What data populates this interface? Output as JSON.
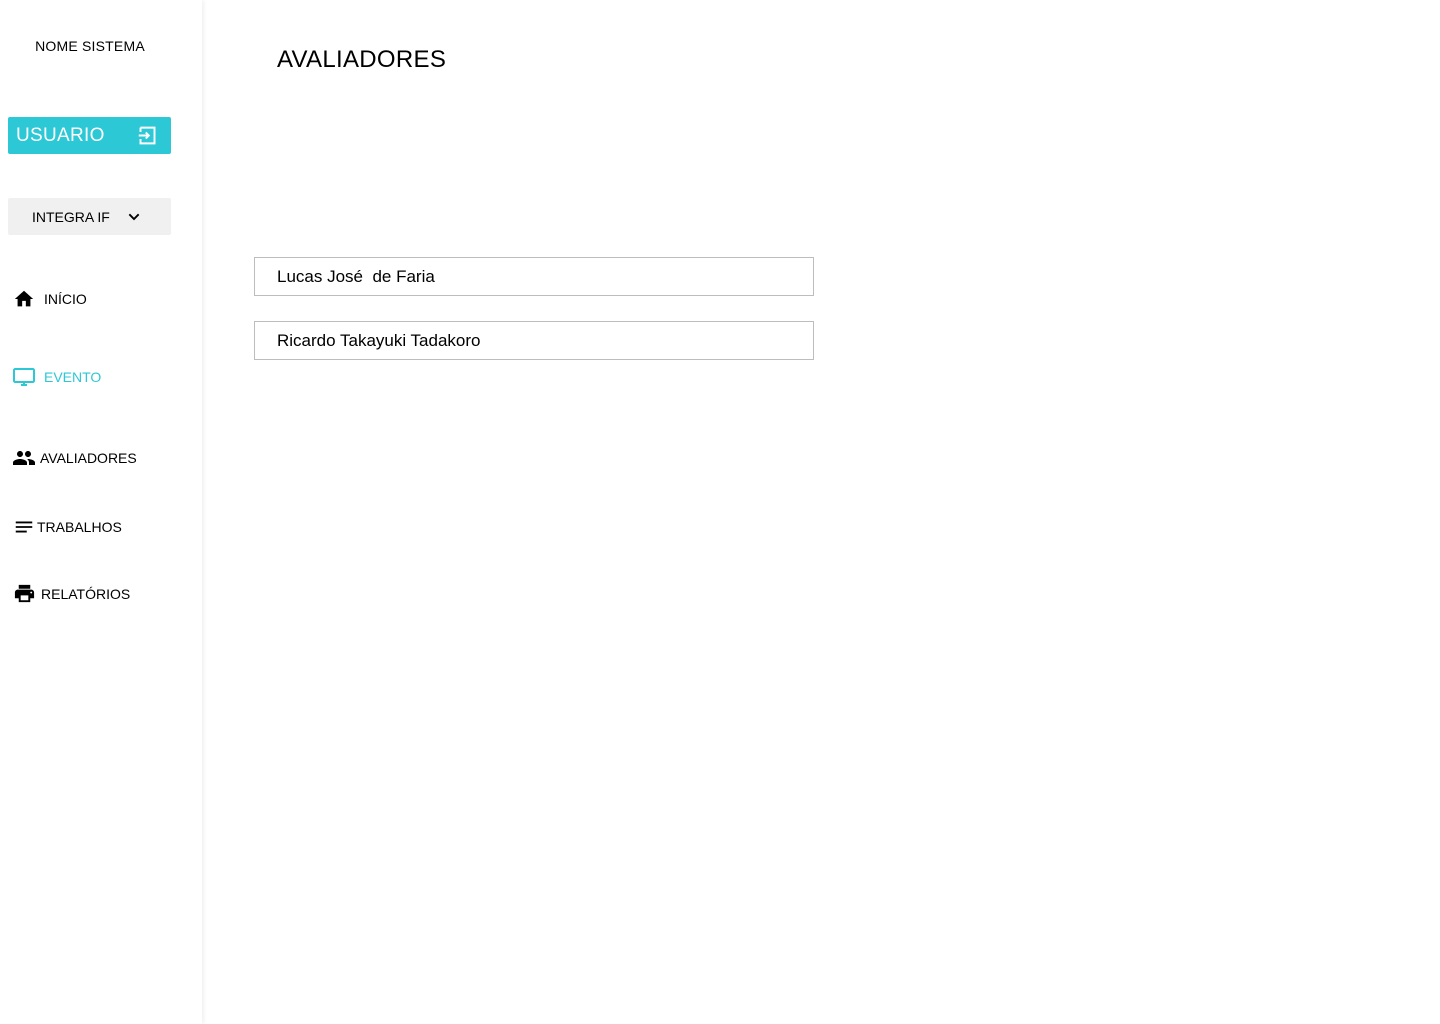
{
  "colors": {
    "accent": "#2cc8d6",
    "select_bg": "#f0f0f0"
  },
  "sidebar": {
    "system_name": "NOME SISTEMA",
    "user_button": {
      "label": "USUARIO",
      "icon": "logout-icon"
    },
    "event_select": {
      "value": "INTEGRA IF",
      "icon": "chevron-down-icon"
    },
    "nav": [
      {
        "label": "INÍCIO",
        "icon": "home-icon",
        "active": false
      },
      {
        "label": "EVENTO",
        "icon": "monitor-icon",
        "active": true
      },
      {
        "label": "AVALIADORES",
        "icon": "people-icon",
        "active": false
      },
      {
        "label": "TRABALHOS",
        "icon": "lines-icon",
        "active": false
      },
      {
        "label": "RELATÓRIOS",
        "icon": "printer-icon",
        "active": false
      }
    ]
  },
  "main": {
    "title": "AVALIADORES",
    "evaluators": [
      {
        "name": "Lucas José  de Faria"
      },
      {
        "name": "Ricardo Takayuki Tadakoro"
      }
    ]
  }
}
